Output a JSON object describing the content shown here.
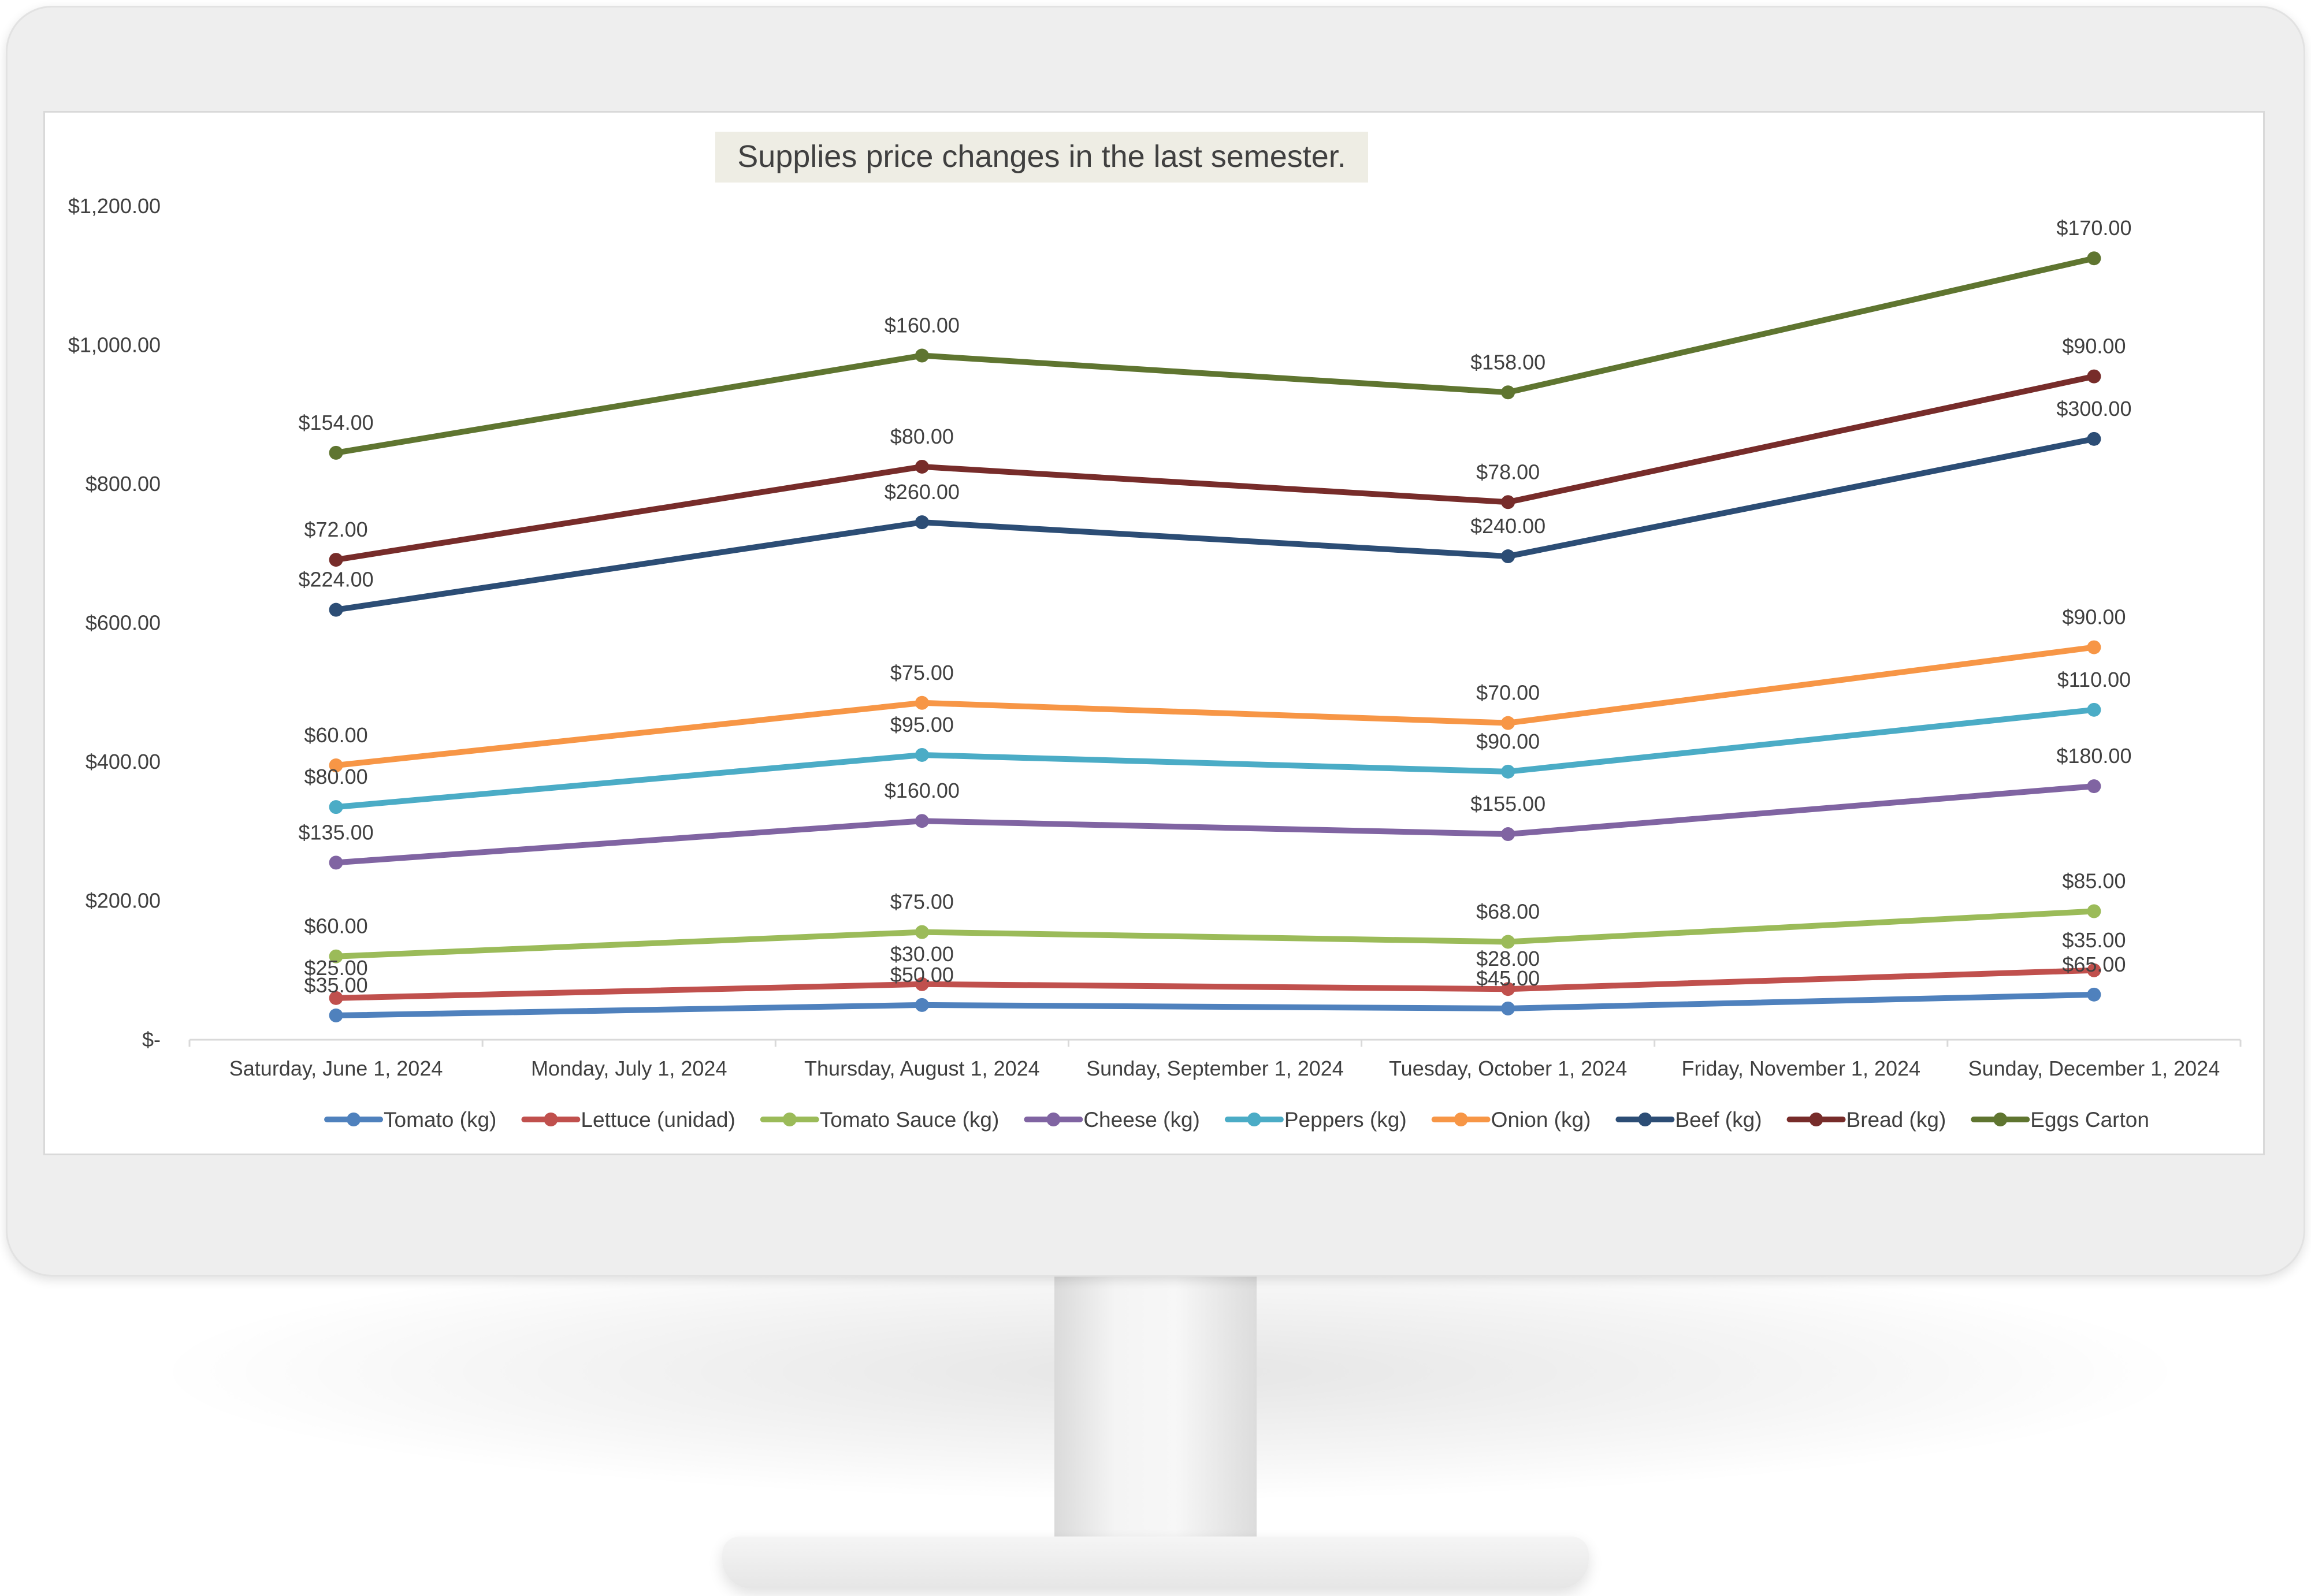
{
  "chart_data": {
    "type": "line",
    "title": "Supplies price changes in the last semester.",
    "xlabel": "",
    "ylabel": "",
    "stacked": true,
    "ylim": [
      0,
      1200
    ],
    "y_ticks": [
      {
        "value": 0,
        "label": "$-"
      },
      {
        "value": 200,
        "label": "$200.00"
      },
      {
        "value": 400,
        "label": "$400.00"
      },
      {
        "value": 600,
        "label": "$600.00"
      },
      {
        "value": 800,
        "label": "$800.00"
      },
      {
        "value": 1000,
        "label": "$1,000.00"
      },
      {
        "value": 1200,
        "label": "$1,200.00"
      }
    ],
    "x_ticks": [
      "Saturday, June 1, 2024",
      "Monday, July 1, 2024",
      "Thursday, August 1, 2024",
      "Sunday, September 1, 2024",
      "Tuesday, October 1, 2024",
      "Friday, November 1, 2024",
      "Sunday, December 1, 2024"
    ],
    "x": [
      "2024-06-01",
      "2024-08-01",
      "2024-10-01",
      "2024-12-01"
    ],
    "legend_position": "bottom",
    "grid": false,
    "series": [
      {
        "name": "Tomato (kg)",
        "color": "#4f81bd",
        "values": [
          35,
          50,
          45,
          65
        ],
        "labels": [
          "$35.00",
          "$50.00",
          "$45.00",
          "$65.00"
        ]
      },
      {
        "name": "Lettuce (unidad)",
        "color": "#c0504d",
        "values": [
          25,
          30,
          28,
          35
        ],
        "labels": [
          "$25.00",
          "$30.00",
          "$28.00",
          "$35.00"
        ]
      },
      {
        "name": "Tomato Sauce (kg)",
        "color": "#9bbb59",
        "values": [
          60,
          75,
          68,
          85
        ],
        "labels": [
          "$60.00",
          "$75.00",
          "$68.00",
          "$85.00"
        ]
      },
      {
        "name": "Cheese (kg)",
        "color": "#8064a2",
        "values": [
          135,
          160,
          155,
          180
        ],
        "labels": [
          "$135.00",
          "$160.00",
          "$155.00",
          "$180.00"
        ]
      },
      {
        "name": "Peppers (kg)",
        "color": "#4bacc6",
        "values": [
          80,
          95,
          90,
          110
        ],
        "labels": [
          "$80.00",
          "$95.00",
          "$90.00",
          "$110.00"
        ]
      },
      {
        "name": "Onion (kg)",
        "color": "#f79646",
        "values": [
          60,
          75,
          70,
          90
        ],
        "labels": [
          "$60.00",
          "$75.00",
          "$70.00",
          "$90.00"
        ]
      },
      {
        "name": "Beef (kg)",
        "color": "#2c4d75",
        "values": [
          224,
          260,
          240,
          300
        ],
        "labels": [
          "$224.00",
          "$260.00",
          "$240.00",
          "$300.00"
        ]
      },
      {
        "name": "Bread (kg)",
        "color": "#772c2a",
        "values": [
          72,
          80,
          78,
          90
        ],
        "labels": [
          "$72.00",
          "$80.00",
          "$78.00",
          "$90.00"
        ]
      },
      {
        "name": "Eggs Carton",
        "color": "#5f7530",
        "values": [
          154,
          160,
          158,
          170
        ],
        "labels": [
          "$154.00",
          "$160.00",
          "$158.00",
          "$170.00"
        ]
      }
    ]
  }
}
